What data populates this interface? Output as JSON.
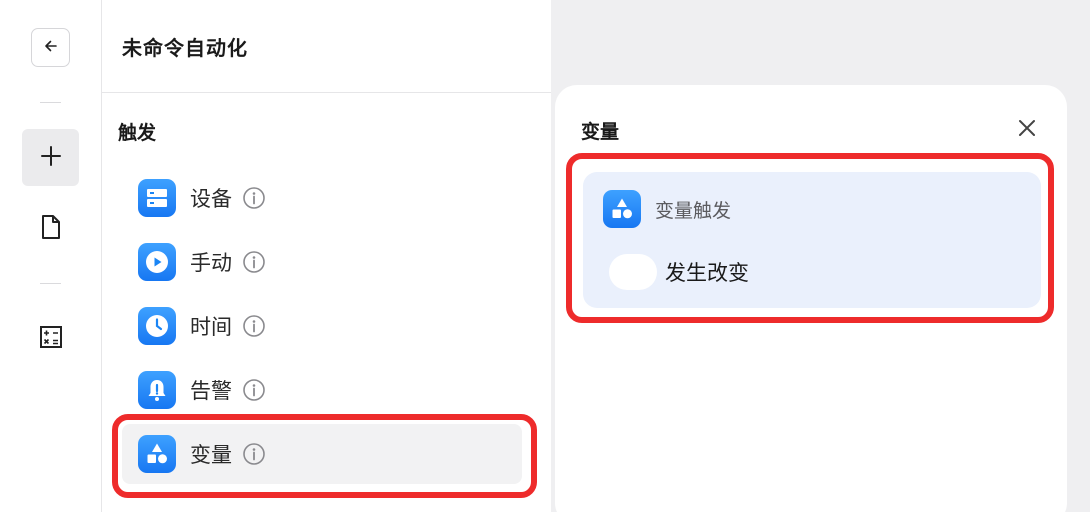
{
  "rail": {
    "back_icon": "arrow-left-icon",
    "add_icon": "plus-icon",
    "document_icon": "document-icon",
    "calculator_icon": "calculator-icon"
  },
  "panel": {
    "title": "未命令自动化",
    "section_title": "触发",
    "items": [
      {
        "label": "设备",
        "icon": "device-server-icon"
      },
      {
        "label": "手动",
        "icon": "play-icon"
      },
      {
        "label": "时间",
        "icon": "clock-icon"
      },
      {
        "label": "告警",
        "icon": "alarm-bell-icon"
      },
      {
        "label": "变量",
        "icon": "variable-shapes-icon"
      }
    ],
    "selected_index": 4
  },
  "drawer": {
    "title": "变量",
    "close_icon": "close-icon",
    "card_title": "变量触发",
    "option_label": "发生改变",
    "toggle_on": false
  },
  "colors": {
    "accent": "#1777f2",
    "highlight": "#ee2b2b",
    "card_bg": "#eaf0fc",
    "selected_bg": "#f2f2f3"
  }
}
